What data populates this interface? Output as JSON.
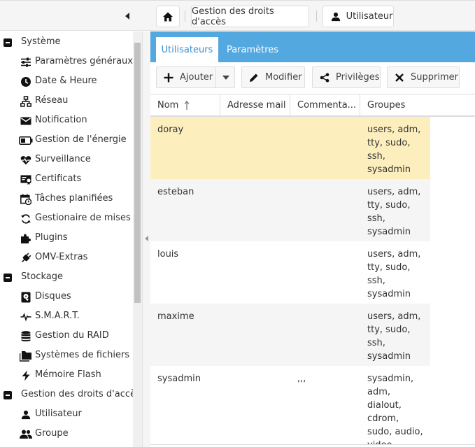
{
  "breadcrumb": {
    "home_icon": "home-icon",
    "section": "Gestion des droits d'accès",
    "page": "Utilisateur",
    "page_icon": "person-icon"
  },
  "sidebar": {
    "systeme": {
      "label": "Système",
      "items": [
        {
          "label": "Paramètres généraux",
          "icon": "sliders-icon"
        },
        {
          "label": "Date & Heure",
          "icon": "clock-icon"
        },
        {
          "label": "Réseau",
          "icon": "network-icon"
        },
        {
          "label": "Notification",
          "icon": "mail-icon"
        },
        {
          "label": "Gestion de l'énergie",
          "icon": "battery-icon"
        },
        {
          "label": "Surveillance",
          "icon": "heartbeat-icon"
        },
        {
          "label": "Certificats",
          "icon": "certificate-icon"
        },
        {
          "label": "Tâches planifiées",
          "icon": "calendar-clock-icon"
        },
        {
          "label": "Gestionaire de mises à",
          "icon": "refresh-icon"
        },
        {
          "label": "Plugins",
          "icon": "puzzle-icon"
        },
        {
          "label": "OMV-Extras",
          "icon": "plug-icon"
        }
      ]
    },
    "stockage": {
      "label": "Stockage",
      "items": [
        {
          "label": "Disques",
          "icon": "disk-icon"
        },
        {
          "label": "S.M.A.R.T.",
          "icon": "pulse-icon"
        },
        {
          "label": "Gestion du RAID",
          "icon": "database-icon"
        },
        {
          "label": "Systèmes de fichiers",
          "icon": "folders-icon"
        },
        {
          "label": "Mémoire Flash",
          "icon": "flash-icon"
        }
      ]
    },
    "droits": {
      "label": "Gestion des droits d'accès",
      "items": [
        {
          "label": "Utilisateur",
          "icon": "person-icon"
        },
        {
          "label": "Groupe",
          "icon": "group-icon"
        }
      ]
    }
  },
  "tabs": {
    "users": "Utilisateurs",
    "params": "Paramètres"
  },
  "toolbar": {
    "add": "Ajouter",
    "edit": "Modifier",
    "privileges": "Privilèges",
    "delete": "Supprimer"
  },
  "grid": {
    "columns": {
      "name": "Nom",
      "mail": "Adresse mail",
      "comment": "Commenta...",
      "groups": "Groupes"
    },
    "rows": [
      {
        "name": "doray",
        "mail": "",
        "comment": "",
        "groups": "users, adm, tty, sudo, ssh, sysadmin"
      },
      {
        "name": "esteban",
        "mail": "",
        "comment": "",
        "groups": "users, adm, tty, sudo, ssh, sysadmin"
      },
      {
        "name": "louis",
        "mail": "",
        "comment": "",
        "groups": "users, adm, tty, sudo, ssh, sysadmin"
      },
      {
        "name": "maxime",
        "mail": "",
        "comment": "",
        "groups": "users, adm, tty, sudo, ssh, sysadmin"
      },
      {
        "name": "sysadmin",
        "mail": "",
        "comment": ",,,",
        "groups": "sysadmin, adm, dialout, cdrom, sudo, audio, video"
      }
    ]
  }
}
